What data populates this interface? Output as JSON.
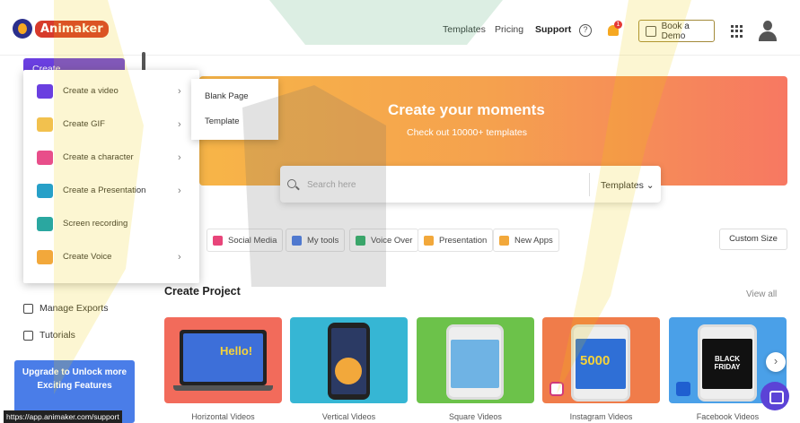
{
  "app": {
    "logo_text": "Animaker"
  },
  "header": {
    "nav": [
      "Templates",
      "Pricing",
      "Support"
    ],
    "help_symbol": "?",
    "notification_count": "1",
    "demo_label": "Book a Demo"
  },
  "sidebar": {
    "create_label": "Create",
    "links": [
      "Manage Exports",
      "Tutorials"
    ],
    "upgrade_line1": "Upgrade to Unlock more",
    "upgrade_line2": "Exciting Features"
  },
  "create_menu": {
    "items": [
      {
        "label": "Create a video",
        "icon": "video-icon",
        "color": "#6a3fe0"
      },
      {
        "label": "Create GIF",
        "icon": "gif-icon",
        "color": "#f2c14e"
      },
      {
        "label": "Create a character",
        "icon": "character-icon",
        "color": "#e84e8a"
      },
      {
        "label": "Create a Presentation",
        "icon": "presentation-icon",
        "color": "#27a0c8"
      },
      {
        "label": "Screen recording",
        "icon": "screen-recording-icon",
        "color": "#2aa7a0"
      },
      {
        "label": "Create Voice",
        "icon": "voice-icon",
        "color": "#f2a83b"
      }
    ],
    "submenu": [
      "Blank Page",
      "Template"
    ]
  },
  "banner": {
    "title": "Create your moments",
    "subtitle": "Check out 10000+ templates"
  },
  "search": {
    "placeholder": "Search here",
    "dropdown_label": "Templates ⌄"
  },
  "chips": [
    {
      "label": "Social Media",
      "color": "#e8457a"
    },
    {
      "label": "My tools",
      "color": "#4a7de8"
    },
    {
      "label": "Voice Over",
      "color": "#2fb36a"
    },
    {
      "label": "Presentation",
      "color": "#f2a83b"
    },
    {
      "label": "New Apps",
      "color": "#f2a83b"
    }
  ],
  "custom_size_label": "Custom Size",
  "project": {
    "title": "Create Project",
    "view_all": "View all",
    "cards": [
      {
        "label": "Horizontal Videos",
        "bg": "#f26b5b",
        "screen_text": "Hello!"
      },
      {
        "label": "Vertical Videos",
        "bg": "#36b6d4",
        "screen_text": ""
      },
      {
        "label": "Square Videos",
        "bg": "#6cc24a",
        "screen_text": ""
      },
      {
        "label": "Instagram Videos",
        "bg": "#f07c4a",
        "screen_text": "5000"
      },
      {
        "label": "Facebook Videos",
        "bg": "#4aa0e8",
        "screen_text": "BLACK FRIDAY"
      }
    ]
  },
  "next_symbol": "›",
  "status_url": "https://app.animaker.com/support"
}
